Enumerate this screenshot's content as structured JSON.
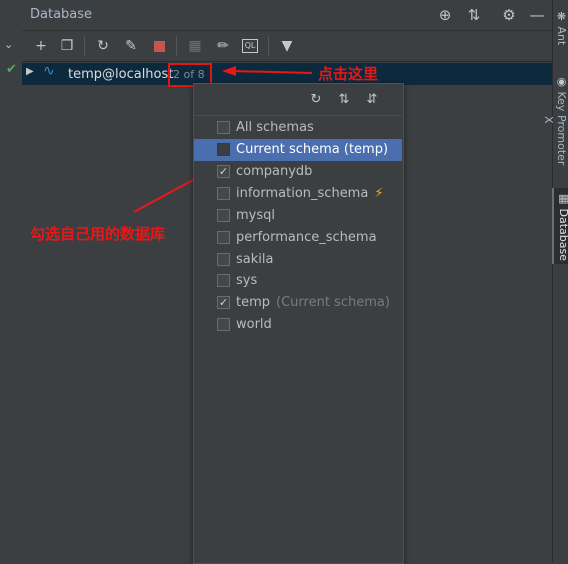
{
  "header": {
    "title": "Database"
  },
  "header_icons": [
    "crosshair-icon",
    "collapse-icon",
    "gear-icon",
    "minimize-icon"
  ],
  "toolbar": {
    "icons": [
      "add-icon",
      "duplicate-icon",
      "refresh-icon",
      "properties-icon",
      "stop-icon",
      "table-icon",
      "edit-icon",
      "console-icon",
      "filter-icon"
    ]
  },
  "tree": {
    "connection": "temp@localhost",
    "schema_count": "2 of 8"
  },
  "popup": {
    "icons": [
      "refresh-icon",
      "expand-all-icon",
      "collapse-all-icon"
    ],
    "items": [
      {
        "label": "All schemas",
        "checked": false,
        "hint": ""
      },
      {
        "label": "Current schema (temp)",
        "checked": false,
        "hint": "",
        "selected": true
      },
      {
        "label": "companydb",
        "checked": true,
        "hint": ""
      },
      {
        "label": "information_schema",
        "checked": false,
        "hint": "",
        "icon": "lightning-icon"
      },
      {
        "label": "mysql",
        "checked": false,
        "hint": ""
      },
      {
        "label": "performance_schema",
        "checked": false,
        "hint": ""
      },
      {
        "label": "sakila",
        "checked": false,
        "hint": ""
      },
      {
        "label": "sys",
        "checked": false,
        "hint": ""
      },
      {
        "label": "temp",
        "checked": true,
        "hint": "(Current schema)"
      },
      {
        "label": "world",
        "checked": false,
        "hint": ""
      }
    ]
  },
  "annotations": {
    "click_here": "点击这里",
    "check_db": "勾选自己用的数据库"
  },
  "side_tabs": [
    "Ant",
    "Key Promoter X",
    "Database"
  ],
  "colors": {
    "annotation": "#e81818",
    "selection": "#4b6eaf",
    "connection_row": "#0d293e"
  }
}
